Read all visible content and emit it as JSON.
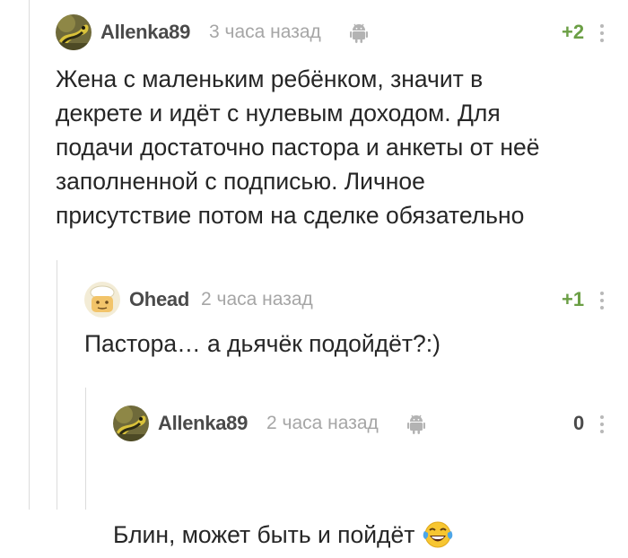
{
  "colors": {
    "username": "#4a4a4a",
    "timestamp": "#a6a6a6",
    "rating_positive": "#6b9f45",
    "rating_zero": "#4a4a4a",
    "thread_line": "#dcdcdc",
    "text": "#262626"
  },
  "comments": [
    {
      "username": "Allenka89",
      "time": "3 часа назад",
      "device_icon": "android-icon",
      "rating": "+2",
      "text": "Жена с маленьким ребёнком, значит в\nдекрете и идёт с нулевым доходом. Для\nподачи достаточно пастора и анкеты от неё\nзаполненной с подписью. Личное\nприсутствие потом на сделке обязательно"
    },
    {
      "username": "Ohead",
      "time": "2 часа назад",
      "rating": "+1",
      "text": "Пастора… а дьячёк подойдёт?:)"
    },
    {
      "username": "Allenka89",
      "time": "2 часа назад",
      "device_icon": "android-icon",
      "rating": "0",
      "text": "Блин, может быть и пойдёт",
      "emoji": "laughing-tears-emoji"
    }
  ]
}
